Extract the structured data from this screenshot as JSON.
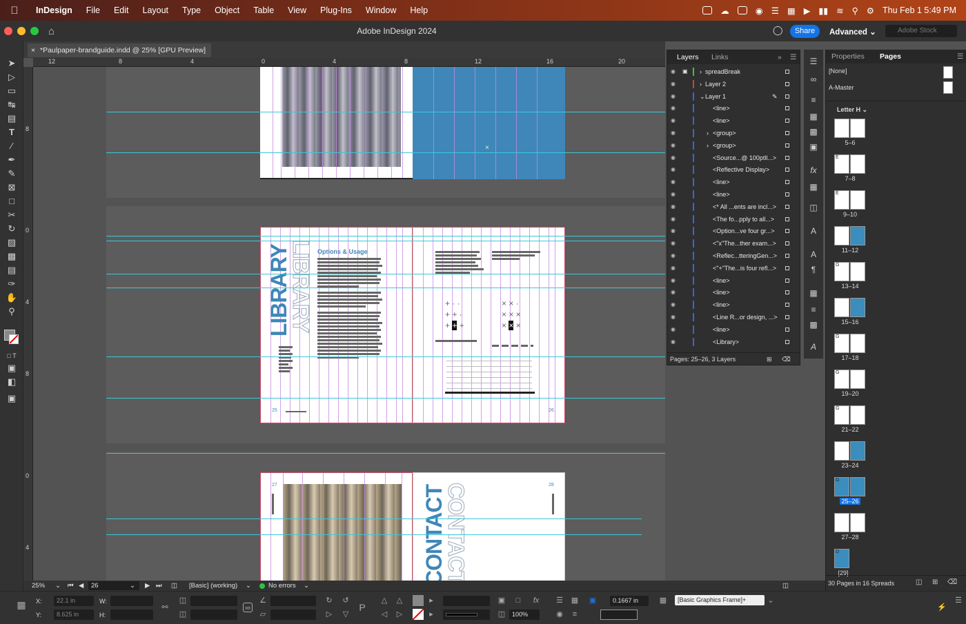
{
  "menubar": {
    "app_name": "InDesign",
    "items": [
      "File",
      "Edit",
      "Layout",
      "Type",
      "Object",
      "Table",
      "View",
      "Plug-Ins",
      "Window",
      "Help"
    ],
    "datetime": "Thu Feb 1  5:49 PM"
  },
  "appbar": {
    "title": "Adobe InDesign 2024",
    "share_label": "Share",
    "workspace": "Advanced",
    "stock_placeholder": "Adobe Stock"
  },
  "document_tab": {
    "title": "*Paulpaper-brandguide.indd @ 25% [GPU Preview]"
  },
  "hruler": [
    "12",
    "8",
    "4",
    "0",
    "4",
    "8",
    "12",
    "16",
    "20"
  ],
  "vruler": [
    "8",
    "0",
    "4",
    "8",
    "0",
    "4"
  ],
  "spread2": {
    "heading": "Options & Usage",
    "vertical_title": "LIBRARY",
    "page_left": "25",
    "page_right": "26"
  },
  "spread3": {
    "vertical_title": "CONTACT",
    "page_left": "27",
    "page_right": "28"
  },
  "layers_panel": {
    "tabs": [
      "Layers",
      "Links"
    ],
    "rows": [
      {
        "name": "spreadBreak",
        "color": "#33cc33"
      },
      {
        "name": "Layer 2",
        "color": "#e03a3a"
      },
      {
        "name": "Layer 1",
        "color": "#3a62e0"
      },
      {
        "name": "<line>",
        "color": "#3a62e0"
      },
      {
        "name": "<line>",
        "color": "#3a62e0"
      },
      {
        "name": "<group>",
        "color": "#3a62e0"
      },
      {
        "name": "<group>",
        "color": "#3a62e0"
      },
      {
        "name": "<Source...@ 100ptll...>",
        "color": "#3a62e0"
      },
      {
        "name": "<Reflective Display>",
        "color": "#3a62e0"
      },
      {
        "name": "<line>",
        "color": "#3a62e0"
      },
      {
        "name": "<line>",
        "color": "#3a62e0"
      },
      {
        "name": "<* All ...ents are incl...>",
        "color": "#3a62e0"
      },
      {
        "name": "<The fo...pply to all...>",
        "color": "#3a62e0"
      },
      {
        "name": "<Option...ve four gr...>",
        "color": "#3a62e0"
      },
      {
        "name": "<\"x\"The...ther exam...>",
        "color": "#3a62e0"
      },
      {
        "name": "<Reflec...tteringGen...>",
        "color": "#3a62e0"
      },
      {
        "name": "<\"+\"The...is four refl...>",
        "color": "#3a62e0"
      },
      {
        "name": "<line>",
        "color": "#3a62e0"
      },
      {
        "name": "<line>",
        "color": "#3a62e0"
      },
      {
        "name": "<line>",
        "color": "#3a62e0"
      },
      {
        "name": "<Line R...or design, ...>",
        "color": "#3a62e0"
      },
      {
        "name": "<line>",
        "color": "#3a62e0"
      },
      {
        "name": "<Library>",
        "color": "#3a62e0"
      }
    ],
    "footer": "Pages: 25–26, 3 Layers"
  },
  "pages_panel": {
    "tabs": [
      "Properties",
      "Pages"
    ],
    "masters": [
      "[None]",
      "A-Master"
    ],
    "size_label": "Letter H",
    "spreads": [
      {
        "label": "5–6",
        "prefix": ""
      },
      {
        "label": "7–8",
        "prefix": "E"
      },
      {
        "label": "9–10",
        "prefix": "E"
      },
      {
        "label": "11–12",
        "prefix": ""
      },
      {
        "label": "13–14",
        "prefix": "G"
      },
      {
        "label": "15–16",
        "prefix": ""
      },
      {
        "label": "17–18",
        "prefix": "G"
      },
      {
        "label": "19–20",
        "prefix": "G"
      },
      {
        "label": "21–22",
        "prefix": "G"
      },
      {
        "label": "23–24",
        "prefix": ""
      },
      {
        "label": "25–26",
        "prefix": "G"
      },
      {
        "label": "27–28",
        "prefix": ""
      },
      {
        "label": "[29]",
        "prefix": "D"
      }
    ],
    "footer": "30 Pages in 16 Spreads"
  },
  "status": {
    "zoom": "25%",
    "page": "26",
    "style": "[Basic] (working)",
    "preflight": "No errors"
  },
  "control": {
    "x_label": "X:",
    "y_label": "Y:",
    "w_label": "W:",
    "h_label": "H:",
    "x_value": "22.1 in",
    "y_value": "8.625 in",
    "zoom_pct": "100%",
    "stroke_weight": "0.1667 in",
    "frame_style": "[Basic Graphics Frame]+"
  }
}
